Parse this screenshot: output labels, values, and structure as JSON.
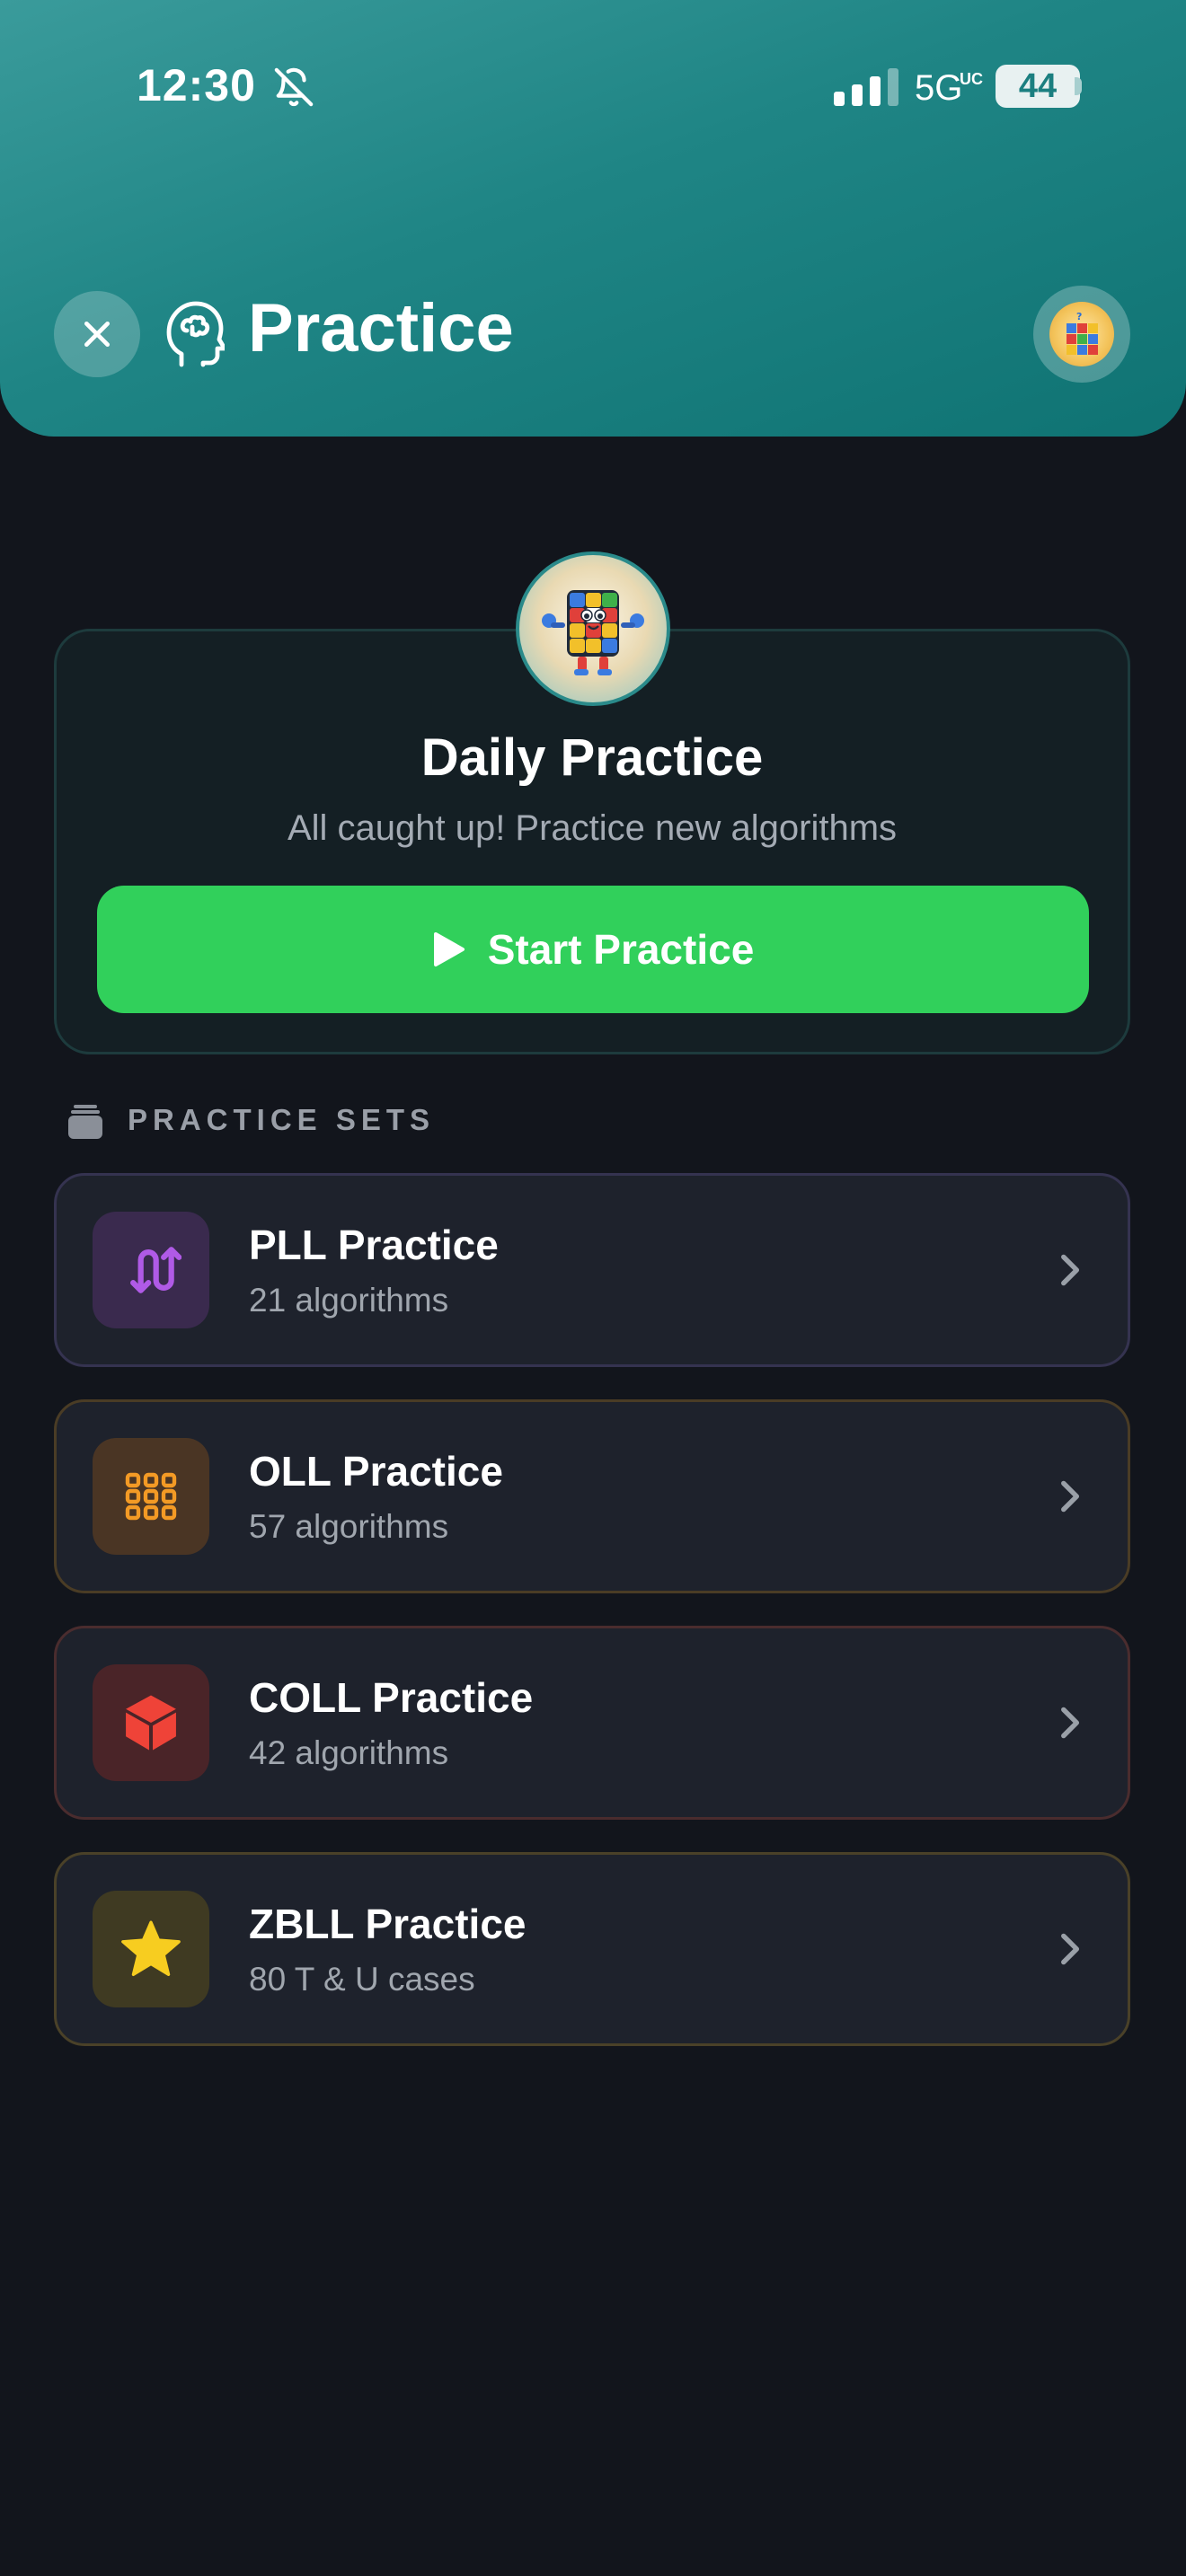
{
  "status_bar": {
    "time": "12:30",
    "network": "5G",
    "network_suffix": "UC",
    "battery": "44"
  },
  "header": {
    "title": "Practice"
  },
  "daily": {
    "title": "Daily Practice",
    "subtitle": "All caught up! Practice new algorithms",
    "button_label": "Start Practice"
  },
  "sets": {
    "section_label": "PRACTICE SETS",
    "items": [
      {
        "title": "PLL Practice",
        "subtitle": "21 algorithms",
        "icon": "swap-arrows-icon",
        "accent": "#b05ae6",
        "bg": "#3a2a4e",
        "border": "#3a3350"
      },
      {
        "title": "OLL Practice",
        "subtitle": "57 algorithms",
        "icon": "grid-icon",
        "accent": "#f39a25",
        "bg": "#4a3524",
        "border": "#4a3c25"
      },
      {
        "title": "COLL Practice",
        "subtitle": "42 algorithms",
        "icon": "cube-icon",
        "accent": "#ef4338",
        "bg": "#4a2428",
        "border": "#4a2c2c"
      },
      {
        "title": "ZBLL Practice",
        "subtitle": "80 T & U cases",
        "icon": "star-icon",
        "accent": "#f7cd20",
        "bg": "#3f3a22",
        "border": "#4a4128"
      }
    ]
  },
  "colors": {
    "header_start": "#3a9b9b",
    "header_end": "#0f7373",
    "background": "#12151c",
    "primary_button": "#31d05b"
  }
}
